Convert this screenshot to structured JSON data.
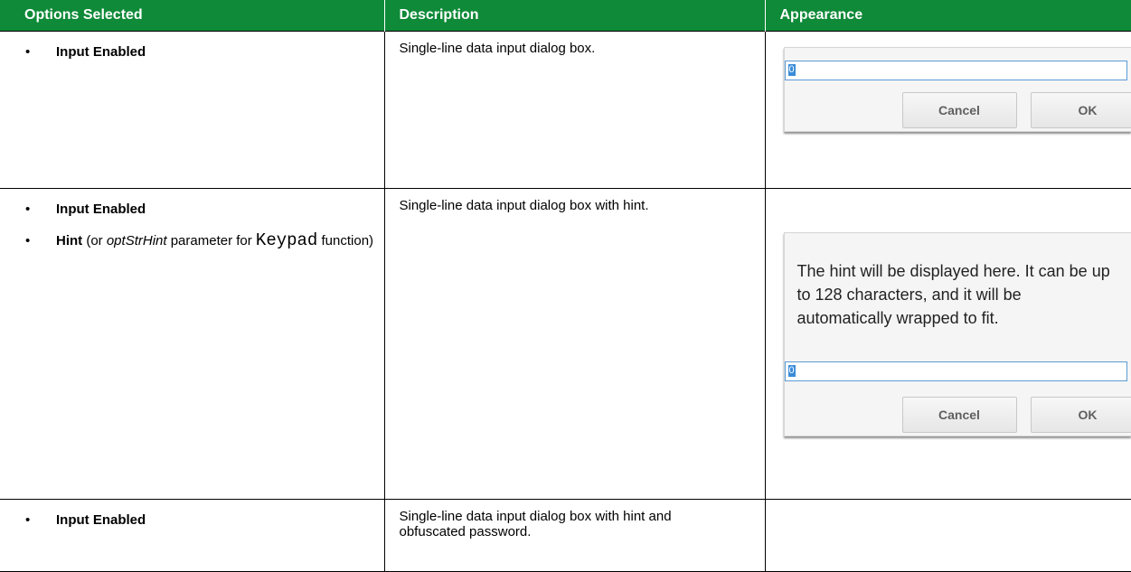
{
  "headers": [
    "Options Selected",
    "Description",
    "Appearance"
  ],
  "rows": [
    {
      "options": [
        {
          "bold": "Input Enabled"
        }
      ],
      "description": "Single-line data input dialog box.",
      "dialog": {
        "value": "0",
        "cancel": "Cancel",
        "ok": "OK"
      }
    },
    {
      "options": [
        {
          "bold": "Input Enabled"
        },
        {
          "bold": "Hint",
          "t1": " (or ",
          "em": "optStrHint",
          "t2": " parameter for ",
          "mono": "Keypad",
          "t3": " function)"
        }
      ],
      "description": "Single-line data input dialog box with hint.",
      "dialog": {
        "hint": "The hint will be displayed here. It can be up to 128 characters, and it will be automatically wrapped to fit.",
        "value": "0",
        "cancel": "Cancel",
        "ok": "OK"
      }
    },
    {
      "options": [
        {
          "bold": "Input Enabled"
        }
      ],
      "description": "Single-line data input dialog box with hint and obfuscated password."
    }
  ],
  "bullet": "•",
  "colors": {
    "header_bg": "#0e8a38",
    "header_text": "#ffffff",
    "input_border": "#5b9bd5",
    "selection": "#3a8cd8"
  }
}
